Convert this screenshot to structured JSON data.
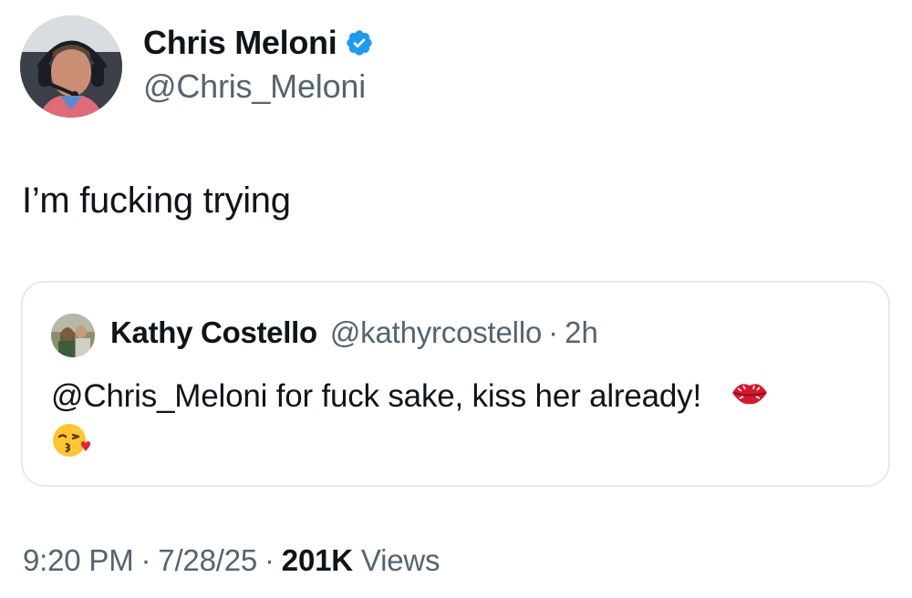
{
  "tweet": {
    "author": {
      "display_name": "Chris Meloni",
      "handle": "@Chris_Meloni",
      "verified": true
    },
    "text": "I’m fucking trying",
    "quoted": {
      "display_name": "Kathy Costello",
      "handle": "@kathyrcostello",
      "separator": "·",
      "time": "2h",
      "text": "@Chris_Meloni for fuck sake, kiss her already!",
      "emojis": [
        "lips-emoji",
        "face-blowing-kiss-emoji"
      ]
    },
    "meta": {
      "time": "9:20 PM",
      "separator": "·",
      "date": "7/28/25",
      "views_count": "201K",
      "views_label": "Views"
    }
  },
  "colors": {
    "text_primary": "#0f1419",
    "text_secondary": "#536471",
    "verified_blue": "#1d9bf0",
    "border": "#e6e9eb"
  }
}
